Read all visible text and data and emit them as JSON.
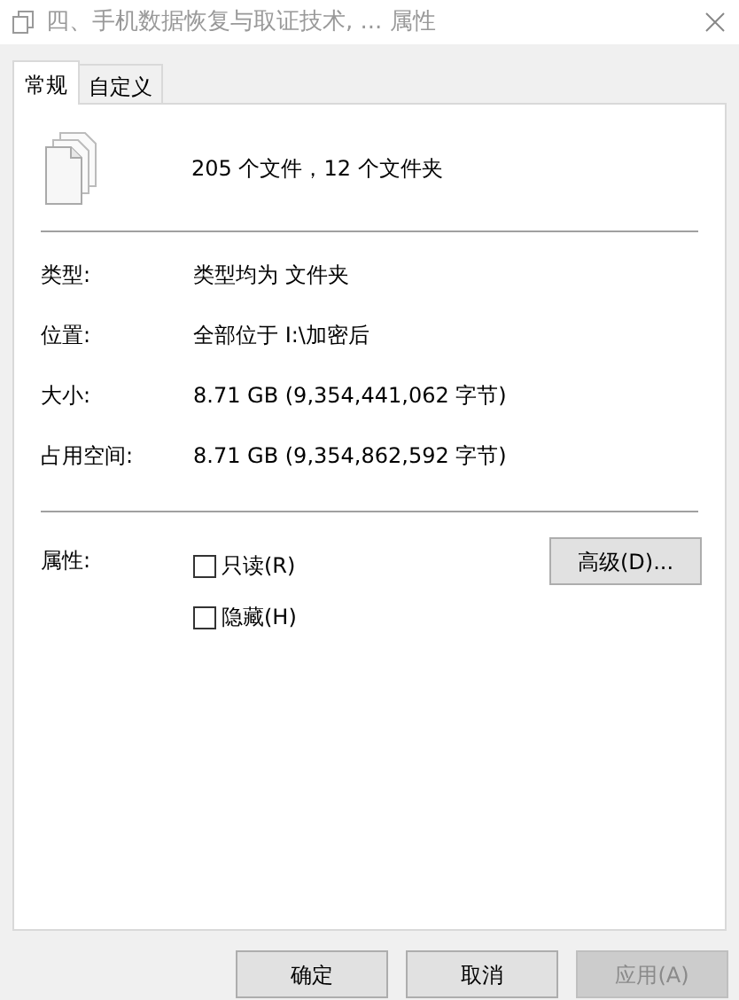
{
  "window": {
    "title": "四、手机数据恢复与取证技术, ... 属性"
  },
  "tabs": [
    {
      "label": "常规",
      "selected": true
    },
    {
      "label": "自定义",
      "selected": false
    }
  ],
  "summary": "205 个文件，12 个文件夹",
  "details": [
    {
      "label": "类型:",
      "value": "类型均为 文件夹"
    },
    {
      "label": "位置:",
      "value": "全部位于 I:\\加密后"
    },
    {
      "label": "大小:",
      "value": "8.71 GB (9,354,441,062 字节)"
    },
    {
      "label": "占用空间:",
      "value": "8.71 GB (9,354,862,592 字节)"
    }
  ],
  "attributes": {
    "label": "属性:",
    "options": [
      {
        "label": "只读(R)",
        "checked": false
      },
      {
        "label": "隐藏(H)",
        "checked": false
      }
    ],
    "advanced_button": "高级(D)..."
  },
  "buttons": [
    {
      "label": "确定",
      "disabled": false
    },
    {
      "label": "取消",
      "disabled": false
    },
    {
      "label": "应用(A)",
      "disabled": true
    }
  ]
}
